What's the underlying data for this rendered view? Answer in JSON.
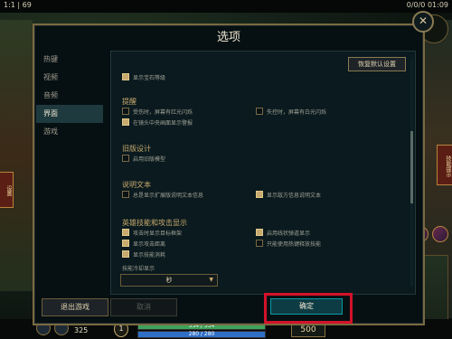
{
  "hud": {
    "top_left": "1:1 | 69",
    "top_right": "0/0/0 01:09",
    "left_tab": "设置",
    "right_tab": "技能提示",
    "level": "1",
    "hp": "554 / 554",
    "hp_ratio": 1.0,
    "mp": "280 / 280",
    "mp_ratio": 1.0,
    "gold": "500",
    "stat": "325"
  },
  "dialog": {
    "title": "选项",
    "close": "✕",
    "reset_button": "恢复默认设置",
    "sidebar": [
      {
        "label": "热键",
        "active": false
      },
      {
        "label": "视频",
        "active": false
      },
      {
        "label": "音频",
        "active": false
      },
      {
        "label": "界面",
        "active": true
      },
      {
        "label": "游戏",
        "active": false
      }
    ],
    "top_option": "显示宝石等级",
    "sections": {
      "alerts": {
        "title": "提醒",
        "opt1": "受伤时，屏幕有红光闪烁",
        "opt2": "失控时，屏幕有白光闪烁",
        "opt3": "在镜头中央画面显示警报"
      },
      "legacy": {
        "title": "旧版设计",
        "opt1": "启用旧版模型"
      },
      "tooltips": {
        "title": "说明文本",
        "opt1": "总是显示扩展版说明文本信息",
        "opt2": "显示敌方信息说明文本"
      },
      "skills": {
        "title": "英雄技能和攻击显示",
        "opt1": "攻击时显示目标框架",
        "opt2": "启用线状弹道显示",
        "opt3": "显示攻击距离",
        "opt4": "只能使用热键释放技能",
        "opt5": "显示技能消耗"
      }
    },
    "cooldown_label": "技能冷却显示",
    "cooldown_value": "秒",
    "footer": {
      "exit": "退出游戏",
      "cancel": "取消",
      "confirm": "确定"
    }
  }
}
